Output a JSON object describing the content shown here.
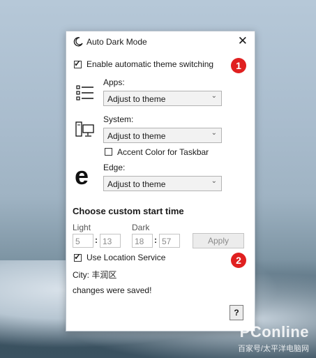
{
  "window": {
    "title": "Auto Dark Mode",
    "close_glyph": "✕"
  },
  "settings": {
    "enable_switching_label": "Enable automatic theme switching",
    "enable_switching_checked": true,
    "apps_label": "Apps:",
    "apps_value": "Adjust to theme",
    "system_label": "System:",
    "system_value": "Adjust to theme",
    "accent_taskbar_label": "Accent Color for Taskbar",
    "accent_taskbar_checked": false,
    "edge_label": "Edge:",
    "edge_value": "Adjust to theme",
    "edge_icon_glyph": "e"
  },
  "schedule": {
    "heading": "Choose custom start time",
    "light_label": "Light",
    "light_hour": "5",
    "light_minute": "13",
    "dark_label": "Dark",
    "dark_hour": "18",
    "dark_minute": "57",
    "separator": ":",
    "apply_label": "Apply",
    "location_label": "Use Location Service",
    "location_checked": true,
    "city_text": "City: 丰润区",
    "status_text": "changes were saved!",
    "help_label": "?"
  },
  "annotations": {
    "marker_1": "1",
    "marker_2": "2",
    "marker_color": "#e02020"
  },
  "watermark": {
    "brand": "PConline",
    "subtitle": "百家号/太平洋电脑网"
  },
  "icons": {
    "moon": "moon-icon",
    "apps": "list-icon",
    "system": "computer-icon",
    "edge": "edge-icon",
    "close": "close-icon",
    "chevron": "chevron-down-icon"
  }
}
